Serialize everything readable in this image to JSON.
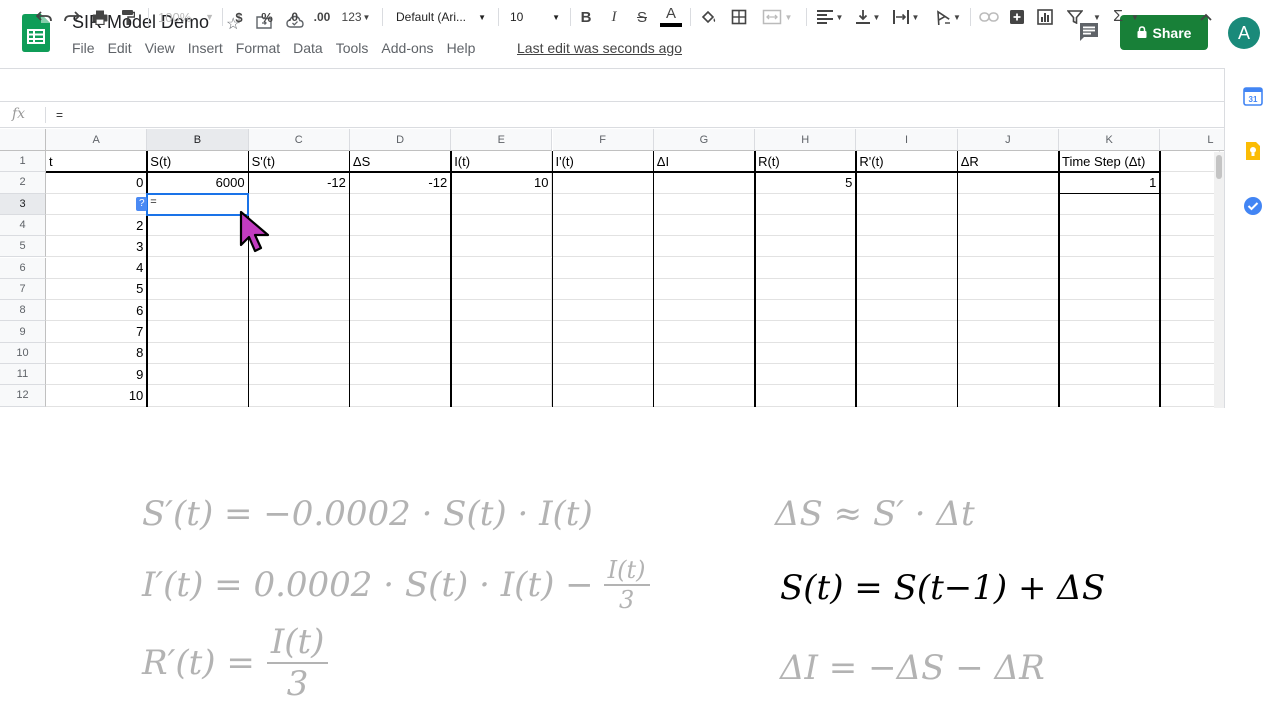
{
  "app": {
    "doc_title": "SIR Model Demo",
    "menu": [
      "File",
      "Edit",
      "View",
      "Insert",
      "Format",
      "Data",
      "Tools",
      "Add-ons",
      "Help"
    ],
    "last_edit": "Last edit was seconds ago",
    "share_label": "Share",
    "avatar_letter": "A",
    "accent_color": "#188038"
  },
  "toolbar": {
    "zoom": "100%",
    "currency": "$",
    "percent": "%",
    "decrease_decimal": ".0",
    "increase_decimal": ".00",
    "format_more": "123",
    "font": "Default (Ari...",
    "font_size": "10",
    "bold": "B",
    "italic": "I",
    "strike": "S",
    "text_color": "A",
    "sum": "Σ"
  },
  "formula_bar": {
    "fx": "fx",
    "value": "="
  },
  "sheet": {
    "columns": [
      "A",
      "B",
      "C",
      "D",
      "E",
      "F",
      "G",
      "H",
      "I",
      "J",
      "K",
      "L"
    ],
    "rows": [
      "1",
      "2",
      "3",
      "4",
      "5",
      "6",
      "7",
      "8",
      "9",
      "10",
      "11",
      "12"
    ],
    "header_row": [
      "t",
      "S(t)",
      "S'(t)",
      "ΔS",
      "I(t)",
      "I'(t)",
      "ΔI",
      "R(t)",
      "R'(t)",
      "ΔR",
      "Time Step (Δt)"
    ],
    "row2": {
      "A": "0",
      "B": "6000",
      "C": "-12",
      "D": "-12",
      "E": "10",
      "H": "5",
      "K": "1"
    },
    "t_values": [
      "2",
      "3",
      "4",
      "5",
      "6",
      "7",
      "8",
      "9",
      "10"
    ],
    "active_cell": "B3",
    "active_cell_value": "=",
    "hint_badge": "?"
  },
  "equations": {
    "s_prime": "S′(t) = −0.0002 · S(t) · I(t)",
    "i_prime_lhs": "I′(t) = 0.0002 · S(t) · I(t) −",
    "i_prime_frac_num": "I(t)",
    "i_prime_frac_den": "3",
    "r_prime_lhs": "R′(t) =",
    "r_prime_frac_num": "I(t)",
    "r_prime_frac_den": "3",
    "delta_s_approx": "ΔS ≈ S′ · Δt",
    "s_update": "S(t) = S(t−1) + ΔS",
    "delta_i": "ΔI = −ΔS − ΔR"
  }
}
